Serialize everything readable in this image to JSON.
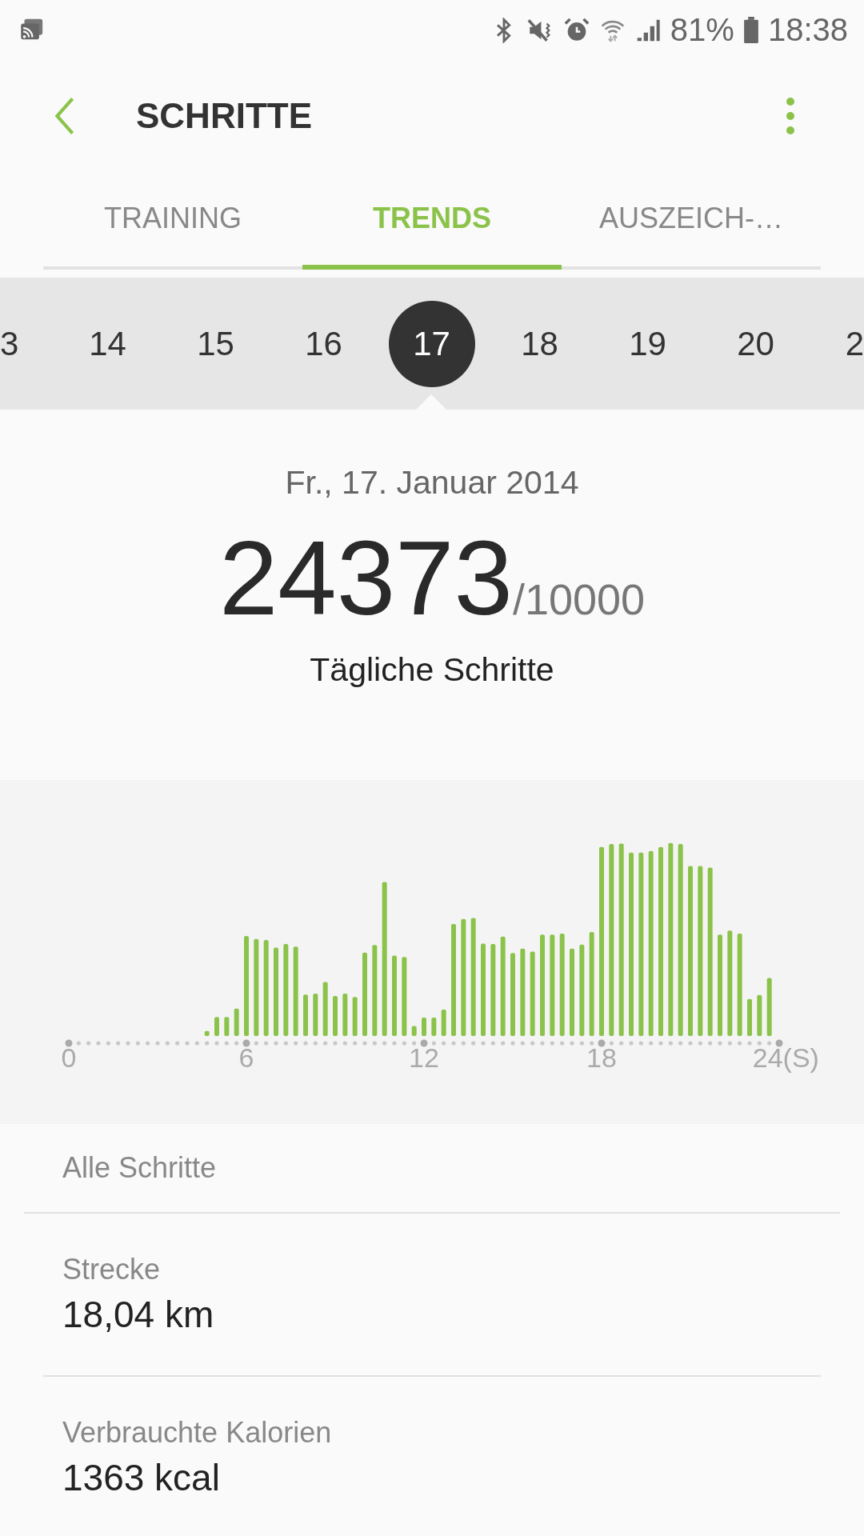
{
  "status_bar": {
    "battery": "81%",
    "time": "18:38"
  },
  "header": {
    "title": "SCHRITTE"
  },
  "tabs": [
    {
      "label": "TRAINING",
      "selected": false
    },
    {
      "label": "TRENDS",
      "selected": true
    },
    {
      "label": "AUSZEICH-…",
      "selected": false
    }
  ],
  "days": [
    {
      "label": "3",
      "selected": false
    },
    {
      "label": "14",
      "selected": false
    },
    {
      "label": "15",
      "selected": false
    },
    {
      "label": "16",
      "selected": false
    },
    {
      "label": "17",
      "selected": true
    },
    {
      "label": "18",
      "selected": false
    },
    {
      "label": "19",
      "selected": false
    },
    {
      "label": "20",
      "selected": false
    },
    {
      "label": "2",
      "selected": false
    }
  ],
  "summary": {
    "date": "Fr., 17. Januar 2014",
    "steps": "24373",
    "goal": "/10000",
    "caption": "Tägliche Schritte"
  },
  "chart": {
    "x_labels": [
      "0",
      "6",
      "12",
      "18",
      "24(S)"
    ]
  },
  "stats": [
    {
      "label": "Alle Schritte"
    },
    {
      "label": "Strecke",
      "value": "18,04 km"
    },
    {
      "label": "Verbrauchte Kalorien",
      "value": "1363 kcal"
    }
  ]
}
